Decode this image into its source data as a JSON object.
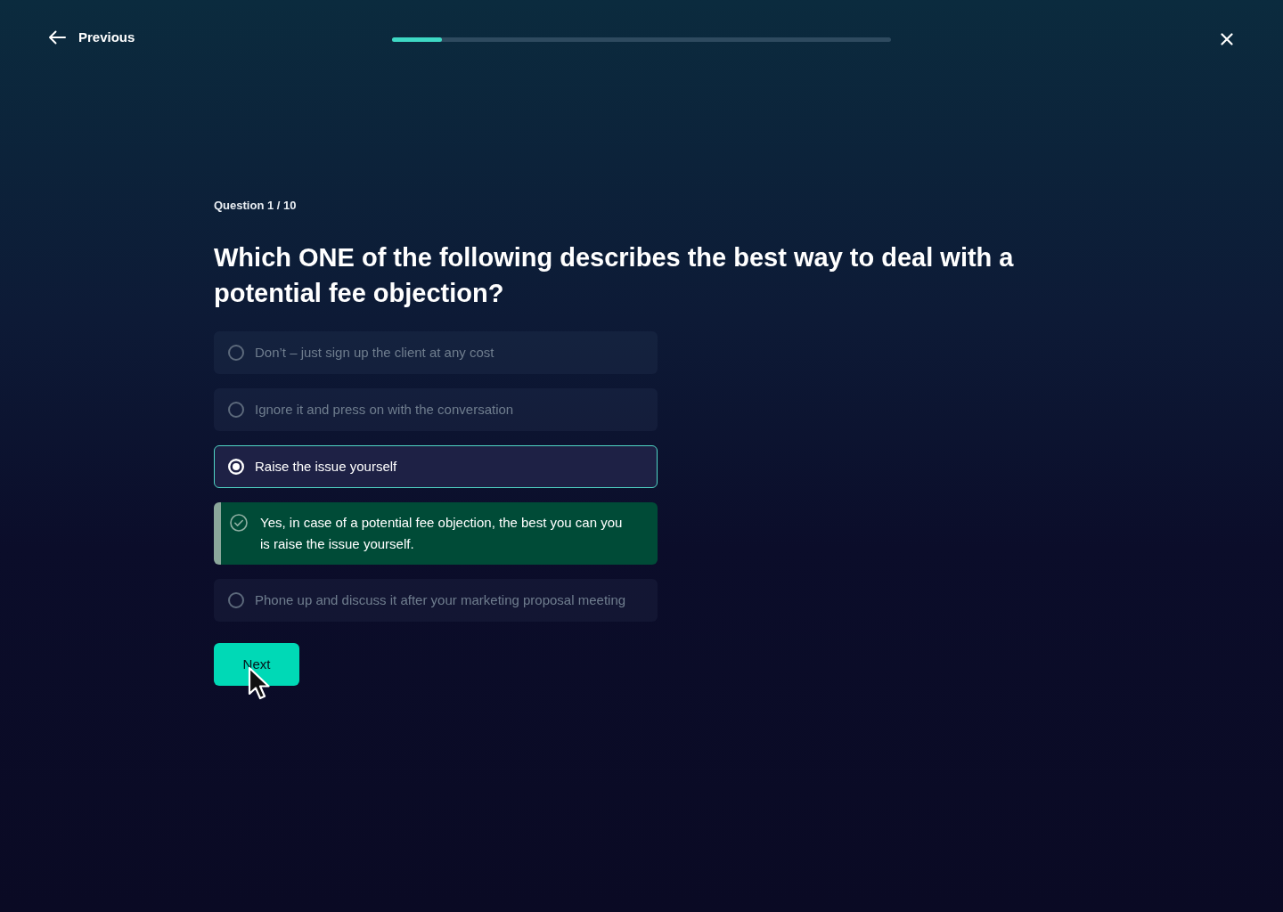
{
  "header": {
    "back_label": "Previous"
  },
  "progress": {
    "level": 0.1
  },
  "question": {
    "counter": "Question 1 / 10",
    "title": "Which ONE of the following describes the best way to deal with a potential fee objection?"
  },
  "options": [
    {
      "kind": "choice",
      "label": "Don’t – just sign up the client at any cost",
      "selected": false
    },
    {
      "kind": "choice",
      "label": "Ignore it and press on with the conversation",
      "selected": false
    },
    {
      "kind": "choice",
      "label": "Raise the issue yourself",
      "selected": true
    },
    {
      "kind": "feedback",
      "text": "Yes, in case of a potential fee objection, the best you can you is raise the issue yourself.",
      "correct": true
    },
    {
      "kind": "choice",
      "label": "Phone up and discuss it after your marketing proposal meeting",
      "selected": false
    }
  ],
  "next_button": {
    "label": "Next"
  }
}
